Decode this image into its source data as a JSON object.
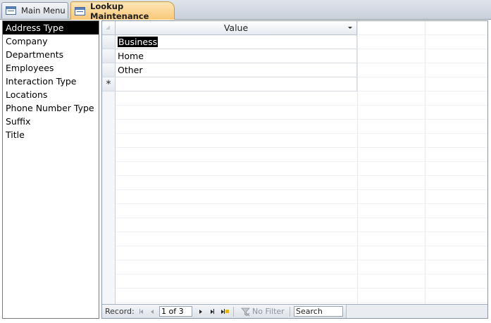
{
  "tabs": [
    {
      "label": "Main Menu",
      "icon": "form-icon",
      "active": false
    },
    {
      "label": "Lookup Maintenance",
      "icon": "form-icon",
      "active": true
    }
  ],
  "list": {
    "items": [
      "Address Type",
      "Company",
      "Departments",
      "Employees",
      "Interaction Type",
      "Locations",
      "Phone Number Type",
      "Suffix",
      "Title"
    ],
    "selected": "Address Type"
  },
  "datasheet": {
    "column_header": "Value",
    "rows": [
      "Business",
      "Home",
      "Other"
    ],
    "new_row_marker": "*"
  },
  "navigation": {
    "record_label": "Record:",
    "record_position": "1 of 3",
    "filter_label": "No Filter",
    "search_placeholder": "Search"
  },
  "colors": {
    "active_tab": "#f9c878",
    "selection": "#000000"
  }
}
